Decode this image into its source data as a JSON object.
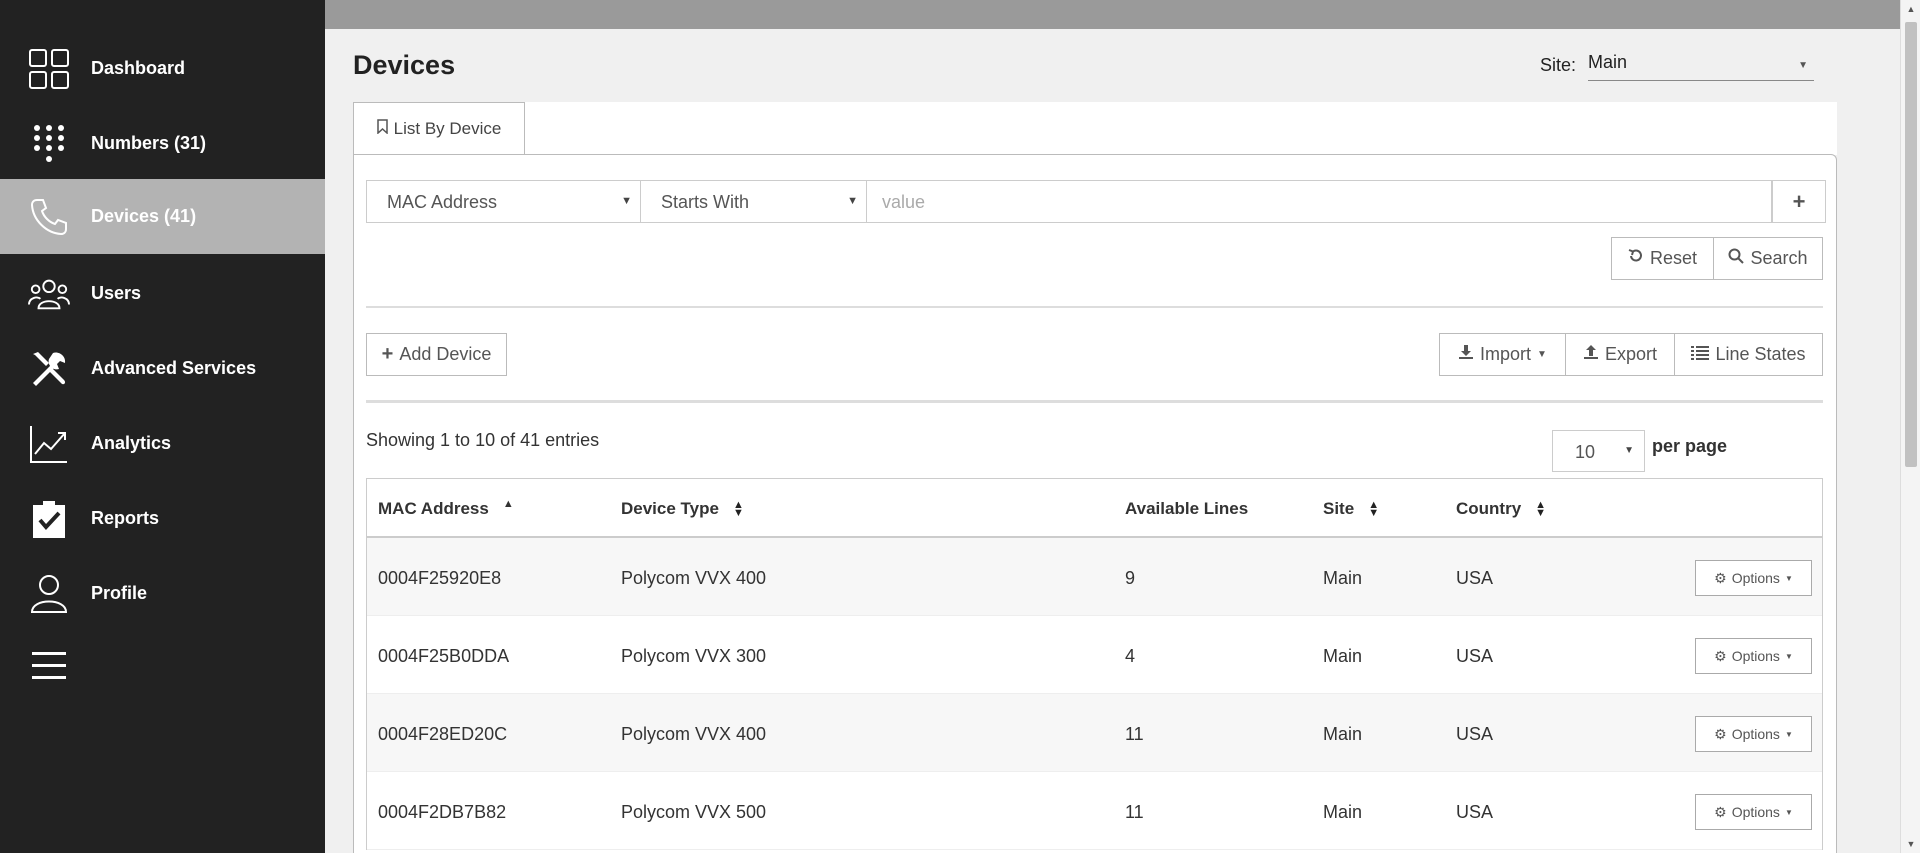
{
  "sidebar": {
    "items": [
      {
        "label": "Dashboard",
        "icon": "dashboard-grid-icon"
      },
      {
        "label": "Numbers (31)",
        "icon": "keypad-icon"
      },
      {
        "label": "Devices (41)",
        "icon": "phone-icon",
        "active": true
      },
      {
        "label": "Users",
        "icon": "users-icon"
      },
      {
        "label": "Advanced Services",
        "icon": "tools-icon"
      },
      {
        "label": "Analytics",
        "icon": "analytics-chart-icon"
      },
      {
        "label": "Reports",
        "icon": "clipboard-check-icon"
      },
      {
        "label": "Profile",
        "icon": "profile-icon"
      }
    ],
    "menu_icon": "hamburger-menu-icon"
  },
  "header": {
    "title": "Devices",
    "site_label": "Site:",
    "site_value": "Main"
  },
  "tabs": [
    {
      "label": "List By Device",
      "icon": "bookmark-icon"
    }
  ],
  "filter": {
    "field": "MAC Address",
    "operator": "Starts With",
    "value_placeholder": "value",
    "add_label": "+"
  },
  "actions": {
    "reset": "Reset",
    "search": "Search",
    "add_device": "Add Device",
    "import": "Import",
    "export": "Export",
    "line_states": "Line States"
  },
  "pagination": {
    "entries_text": "Showing 1 to 10 of 41 entries",
    "per_page_value": "10",
    "per_page_label": "per page"
  },
  "table": {
    "columns": [
      "MAC Address",
      "Device Type",
      "Available Lines",
      "Site",
      "Country"
    ],
    "rows": [
      {
        "mac": "0004F25920E8",
        "type": "Polycom VVX 400",
        "lines": "9",
        "site": "Main",
        "country": "USA"
      },
      {
        "mac": "0004F25B0DDA",
        "type": "Polycom VVX 300",
        "lines": "4",
        "site": "Main",
        "country": "USA"
      },
      {
        "mac": "0004F28ED20C",
        "type": "Polycom VVX 400",
        "lines": "11",
        "site": "Main",
        "country": "USA"
      },
      {
        "mac": "0004F2DB7B82",
        "type": "Polycom VVX 500",
        "lines": "11",
        "site": "Main",
        "country": "USA"
      }
    ],
    "options_label": "Options"
  },
  "colors": {
    "sidebar_bg": "#222222",
    "sidebar_active": "#b3b3b3",
    "topbar": "#9a9a9a"
  }
}
